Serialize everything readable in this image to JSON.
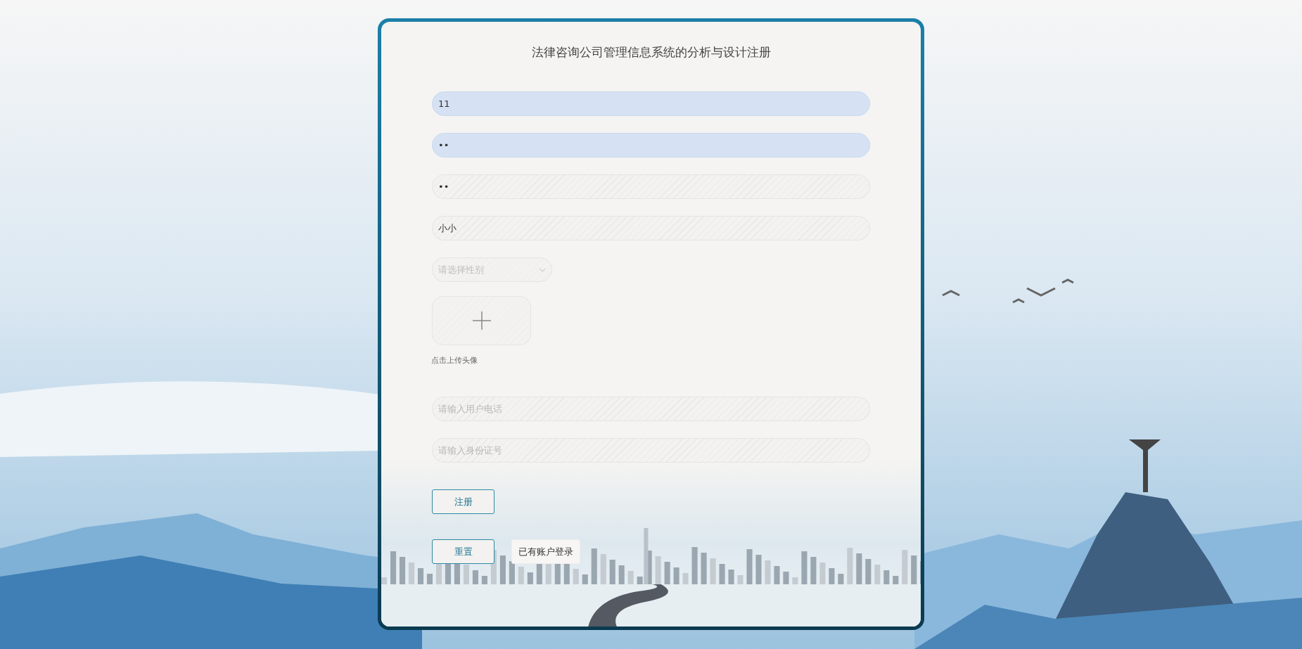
{
  "title": "法律咨询公司管理信息系统的分析与设计注册",
  "fields": [
    {
      "kind": "text",
      "value": "11",
      "autofilled": true
    },
    {
      "kind": "text",
      "value": "••",
      "autofilled": true
    },
    {
      "kind": "text",
      "value": "••",
      "autofilled": false
    },
    {
      "kind": "text",
      "value": "小小",
      "autofilled": false
    },
    {
      "kind": "select",
      "placeholder": "请选择性别"
    },
    {
      "kind": "upload",
      "caption": "点击上传头像"
    },
    {
      "kind": "text",
      "placeholder": "请输入用户电话",
      "autofilled": false
    },
    {
      "kind": "text",
      "placeholder": "请输入身份证号",
      "autofilled": false
    }
  ],
  "buttons": [
    {
      "label": "注册",
      "kind": "outlined"
    },
    {
      "label": "重置",
      "kind": "outlined"
    },
    {
      "label": "已有账户登录",
      "kind": "plain"
    }
  ]
}
